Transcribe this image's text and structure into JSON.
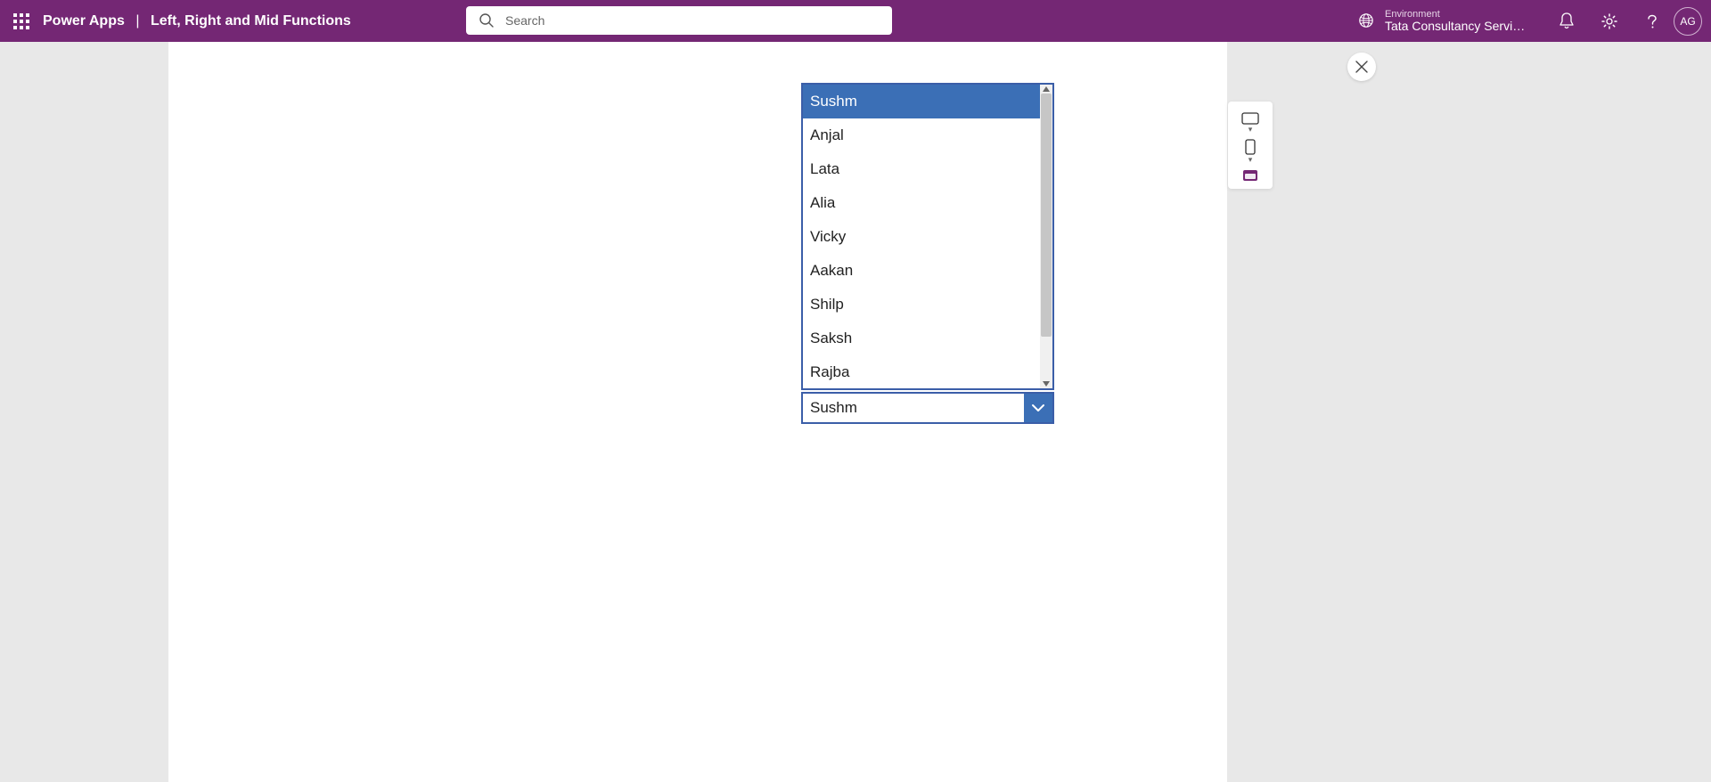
{
  "header": {
    "app_name": "Power Apps",
    "separator": "|",
    "page_title": "Left, Right and Mid Functions",
    "search_placeholder": "Search",
    "environment_label": "Environment",
    "environment_name": "Tata Consultancy Servic...",
    "avatar_initials": "AG"
  },
  "listbox": {
    "items": [
      "Sushm",
      "Anjal",
      "Lata",
      "Alia",
      "Vicky",
      "Aakan",
      "Shilp",
      "Saksh",
      "Rajba"
    ],
    "selected_index": 0
  },
  "dropdown": {
    "selected": "Sushm"
  },
  "colors": {
    "brand": "#742774",
    "accent": "#3b6fb6",
    "border": "#3b5ea8"
  }
}
